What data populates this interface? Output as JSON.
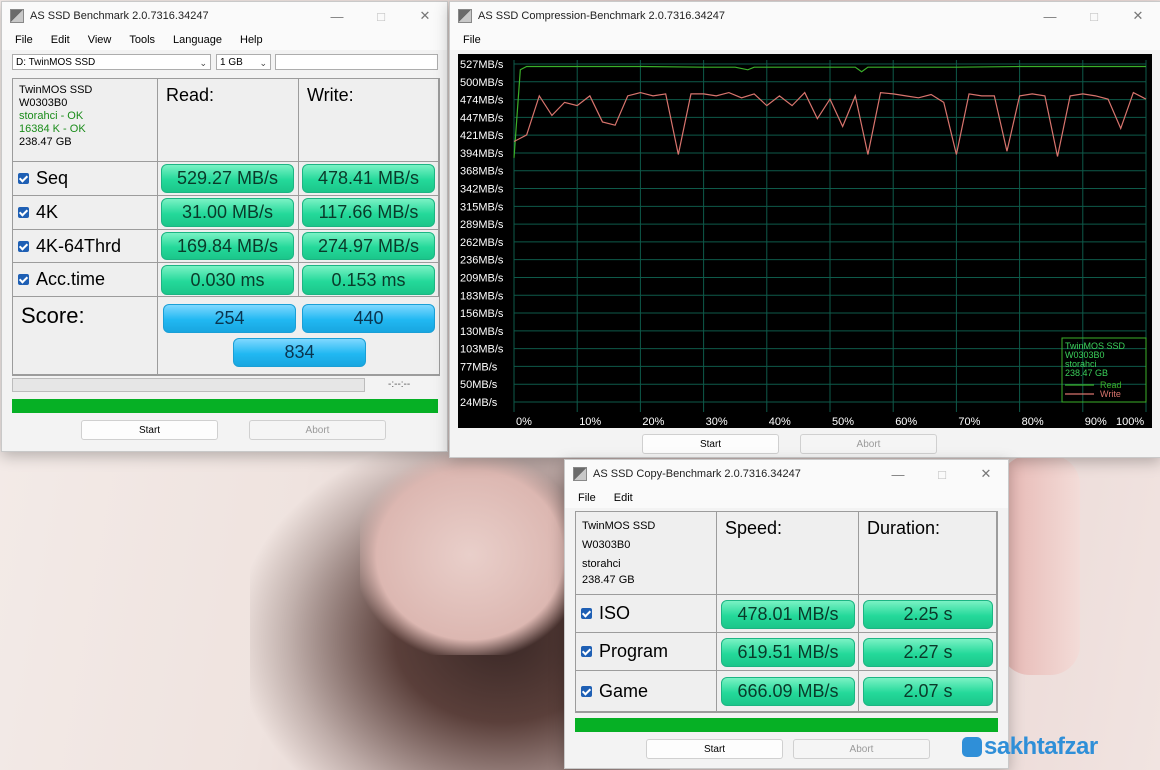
{
  "bench": {
    "title": "AS SSD Benchmark 2.0.7316.34247",
    "menu": [
      "File",
      "Edit",
      "View",
      "Tools",
      "Language",
      "Help"
    ],
    "drive_select": "D: TwinMOS SSD",
    "size_select": "1 GB",
    "device": {
      "name": "TwinMOS SSD",
      "firmware": "W0303B0",
      "driver": "storahci - OK",
      "alignment": "16384 K - OK",
      "capacity": "238.47 GB"
    },
    "read_header": "Read:",
    "write_header": "Write:",
    "rows": [
      {
        "label": "Seq",
        "read": "529.27 MB/s",
        "write": "478.41 MB/s"
      },
      {
        "label": "4K",
        "read": "31.00 MB/s",
        "write": "117.66 MB/s"
      },
      {
        "label": "4K-64Thrd",
        "read": "169.84 MB/s",
        "write": "274.97 MB/s"
      },
      {
        "label": "Acc.time",
        "read": "0.030 ms",
        "write": "0.153 ms"
      }
    ],
    "score_label": "Score:",
    "score_read": "254",
    "score_write": "440",
    "score_total": "834",
    "time": "-:--:--",
    "start": "Start",
    "abort": "Abort",
    "progress": 1.0
  },
  "compression": {
    "title": "AS SSD Compression-Benchmark 2.0.7316.34247",
    "menu": [
      "File"
    ],
    "start": "Start",
    "abort": "Abort",
    "legend": {
      "device": [
        "TwinMOS SSD",
        "W0303B0",
        "storahci",
        "238.47 GB"
      ],
      "read": "Read",
      "write": "Write"
    }
  },
  "copy": {
    "title": "AS SSD Copy-Benchmark 2.0.7316.34247",
    "menu": [
      "File",
      "Edit"
    ],
    "device": {
      "name": "TwinMOS SSD",
      "firmware": "W0303B0",
      "driver": "storahci",
      "capacity": "238.47 GB"
    },
    "speed_header": "Speed:",
    "duration_header": "Duration:",
    "rows": [
      {
        "label": "ISO",
        "speed": "478.01 MB/s",
        "duration": "2.25 s"
      },
      {
        "label": "Program",
        "speed": "619.51 MB/s",
        "duration": "2.27 s"
      },
      {
        "label": "Game",
        "speed": "666.09 MB/s",
        "duration": "2.07 s"
      }
    ],
    "start": "Start",
    "abort": "Abort",
    "progress": 1.0
  },
  "watermark": "sakhtafzar",
  "chart_data": {
    "type": "line",
    "xlabel": "",
    "ylabel": "",
    "x_ticks": [
      "0%",
      "10%",
      "20%",
      "30%",
      "40%",
      "50%",
      "60%",
      "70%",
      "80%",
      "90%",
      "100%"
    ],
    "y_ticks": [
      "527MB/s",
      "500MB/s",
      "474MB/s",
      "447MB/s",
      "421MB/s",
      "394MB/s",
      "368MB/s",
      "342MB/s",
      "315MB/s",
      "289MB/s",
      "262MB/s",
      "236MB/s",
      "209MB/s",
      "183MB/s",
      "156MB/s",
      "130MB/s",
      "103MB/s",
      "77MB/s",
      "50MB/s",
      "24MB/s"
    ],
    "ylim": [
      0,
      540
    ],
    "grid": true,
    "legend": "bottom-right",
    "colors": {
      "read": "#3bb02a",
      "write": "#d8746d",
      "grid": "#0e5a4a"
    },
    "series": [
      {
        "name": "Read",
        "x": [
          0,
          1,
          2,
          3,
          10,
          20,
          30,
          35,
          37,
          38,
          40,
          45,
          50,
          54,
          55,
          56,
          60,
          70,
          80,
          90,
          100
        ],
        "values": [
          390,
          525,
          530,
          530,
          530,
          530,
          529,
          529,
          525,
          529,
          529,
          529,
          529,
          529,
          522,
          529,
          529,
          529,
          530,
          530,
          530
        ]
      },
      {
        "name": "Write",
        "x": [
          0,
          1,
          2,
          4,
          6,
          8,
          10,
          12,
          14,
          16,
          18,
          20,
          22,
          24,
          26,
          28,
          30,
          32,
          34,
          36,
          38,
          40,
          42,
          44,
          46,
          48,
          50,
          52,
          54,
          56,
          58,
          60,
          62,
          64,
          66,
          68,
          70,
          72,
          74,
          76,
          78,
          80,
          82,
          84,
          86,
          88,
          90,
          92,
          94,
          96,
          98,
          100
        ],
        "values": [
          415,
          420,
          425,
          485,
          455,
          475,
          470,
          485,
          445,
          440,
          485,
          490,
          485,
          488,
          395,
          488,
          488,
          485,
          490,
          482,
          488,
          470,
          485,
          470,
          490,
          450,
          480,
          438,
          485,
          395,
          490,
          488,
          485,
          482,
          487,
          475,
          395,
          488,
          485,
          485,
          400,
          485,
          488,
          485,
          392,
          485,
          488,
          485,
          480,
          435,
          490,
          480
        ]
      }
    ]
  }
}
